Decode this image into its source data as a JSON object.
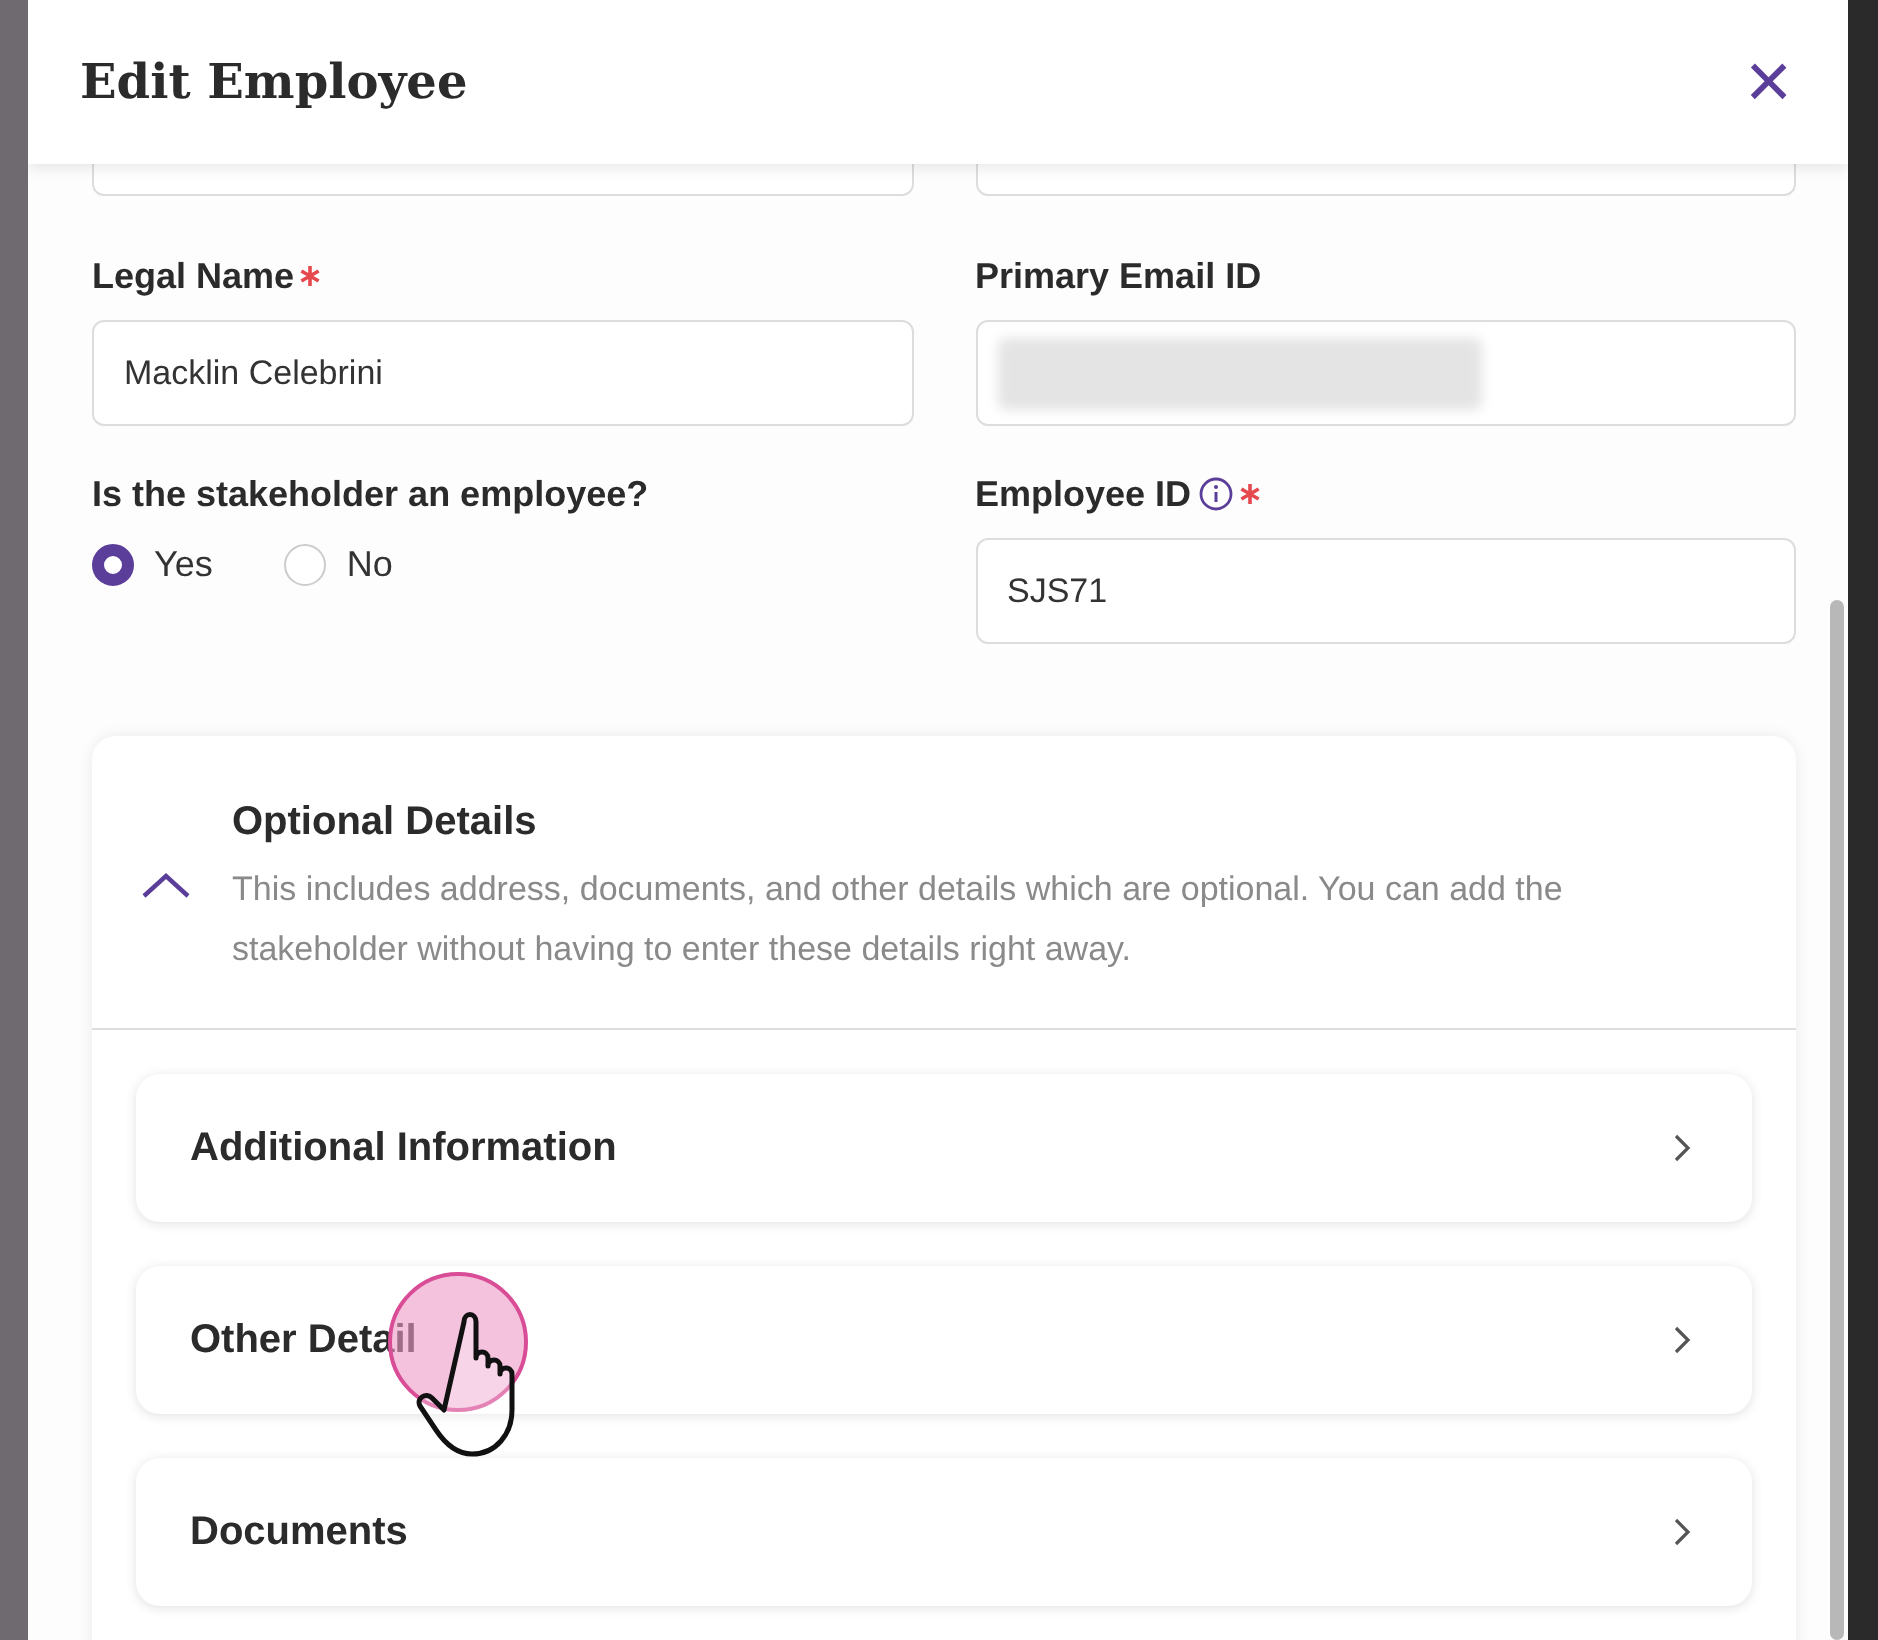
{
  "dialog": {
    "title": "Edit Employee",
    "close_icon": "×"
  },
  "fields": [
    {
      "kind": "text",
      "label": "Legal Name",
      "required": true,
      "info": false,
      "value": "Macklin Celebrini"
    },
    {
      "kind": "redacted",
      "label": "Primary Email ID",
      "required": false,
      "info": false
    },
    {
      "kind": "radio",
      "label": "Is the stakeholder an employee?",
      "options": [
        {
          "label": "Yes",
          "selected": true
        },
        {
          "label": "No",
          "selected": false
        }
      ]
    },
    {
      "kind": "text",
      "label": "Employee ID",
      "required": true,
      "info": true,
      "value": "SJS71"
    }
  ],
  "optional_section": {
    "title": "Optional Details",
    "expanded": true,
    "description": "This includes address, documents, and other details which are optional. You can add the stakeholder without having to enter these details right away.",
    "items": [
      {
        "label": "Additional Information",
        "cursor": false
      },
      {
        "label": "Other Detail",
        "cursor": true
      },
      {
        "label": "Documents",
        "cursor": false
      }
    ]
  }
}
